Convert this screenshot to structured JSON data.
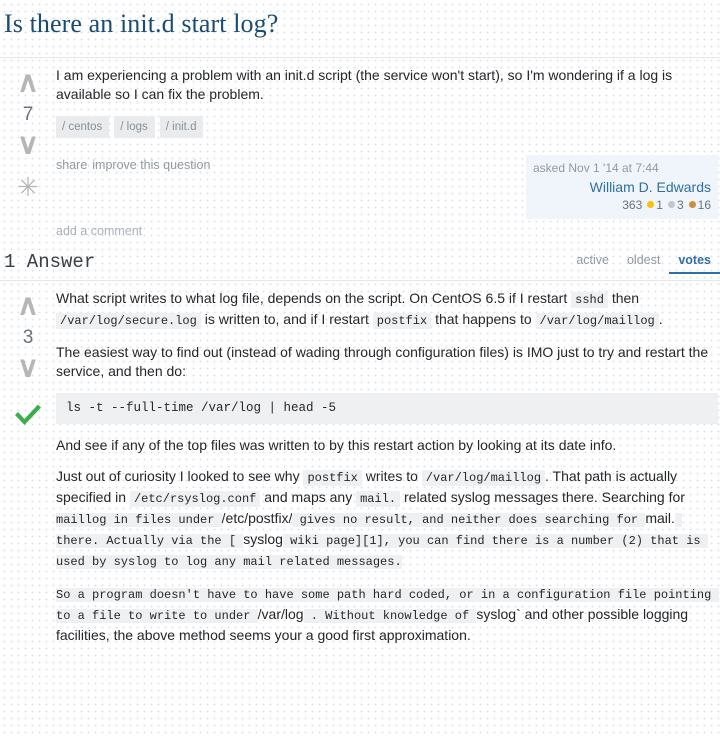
{
  "question": {
    "title": "Is there an init.d start log?",
    "score": "7",
    "vote_up_glyph": "∧",
    "vote_down_glyph": "∨",
    "favorite_glyph": "✳",
    "body_paragraph": "I am experiencing a problem with an init.d script (the service won't start), so I'm wondering if a log is available so I can fix the problem.",
    "tags": [
      "/ centos",
      "/ logs",
      "/ init.d"
    ],
    "menu": {
      "share": "share",
      "improve": "improve this question"
    },
    "owner": {
      "action_time": "asked Nov 1 '14 at 7:44",
      "name": "William D. Edwards",
      "reputation": "363",
      "gold": "1",
      "silver": "3",
      "bronze": "16"
    },
    "add_comment": "add a comment"
  },
  "answers_section": {
    "heading": "1 Answer",
    "tabs": [
      {
        "label": "active",
        "selected": false
      },
      {
        "label": "oldest",
        "selected": false
      },
      {
        "label": "votes",
        "selected": true
      }
    ]
  },
  "answer": {
    "score": "3",
    "vote_up_glyph": "∧",
    "vote_down_glyph": "∨",
    "accepted": true,
    "p1": {
      "t1": "What script writes to what log file, depends on the script. On CentOS 6.5 if I restart ",
      "c1": "sshd",
      "t2": " then ",
      "c2": "/var/log/secure.log",
      "t3": " is written to, and if I restart ",
      "c3": "postfix",
      "t4": " that happens to ",
      "c4": "/var/log/maillog",
      "t5": "."
    },
    "p2": "The easiest way to find out (instead of wading through configuration files) is IMO just to try and restart the service, and then do:",
    "code_block": "ls -t --full-time /var/log | head -5",
    "p3": "And see if any of the top files was written to by this restart action by looking at its date info.",
    "p4": {
      "t1": "Just out of curiosity I looked to see why ",
      "c1": "postfix",
      "t2": " writes to ",
      "c2": "/var/log/maillog",
      "t3": ". That path is actually specified in ",
      "c3": "/etc/rsyslog.conf",
      "t4": " and maps any ",
      "c4": "mail.",
      "t5": " related syslog messages there. Searching for ",
      "m1": "maillog in files under ",
      "t6": "/etc/postfix/",
      "m2": " gives no result, and neither does searching for ",
      "t7": "mail.",
      "m3": " there. Actually via the [ ",
      "t8": "syslog",
      "m4": " wiki page][1], you can find there is a number (2) that is used by syslog to log any mail related messages."
    },
    "p5": {
      "m1": "So a program doesn't have to have some path hard coded, or in a configuration file pointing to a file to write to under ",
      "t1": "/var/log",
      "m2": " . Without knowledge of ",
      "t2": "syslog`",
      "t3": " and other possible logging facilities, the above method seems your a good first approximation."
    }
  },
  "colors": {
    "title": "#1a4c72",
    "link": "#2f6fa3",
    "accepted_check": "#3bad4b",
    "gold": "#fcc006",
    "silver": "#c5c5c5",
    "bronze": "#cc8d3e",
    "code_bg": "#eff0f1",
    "user_card_bg": "#eff5fb"
  }
}
